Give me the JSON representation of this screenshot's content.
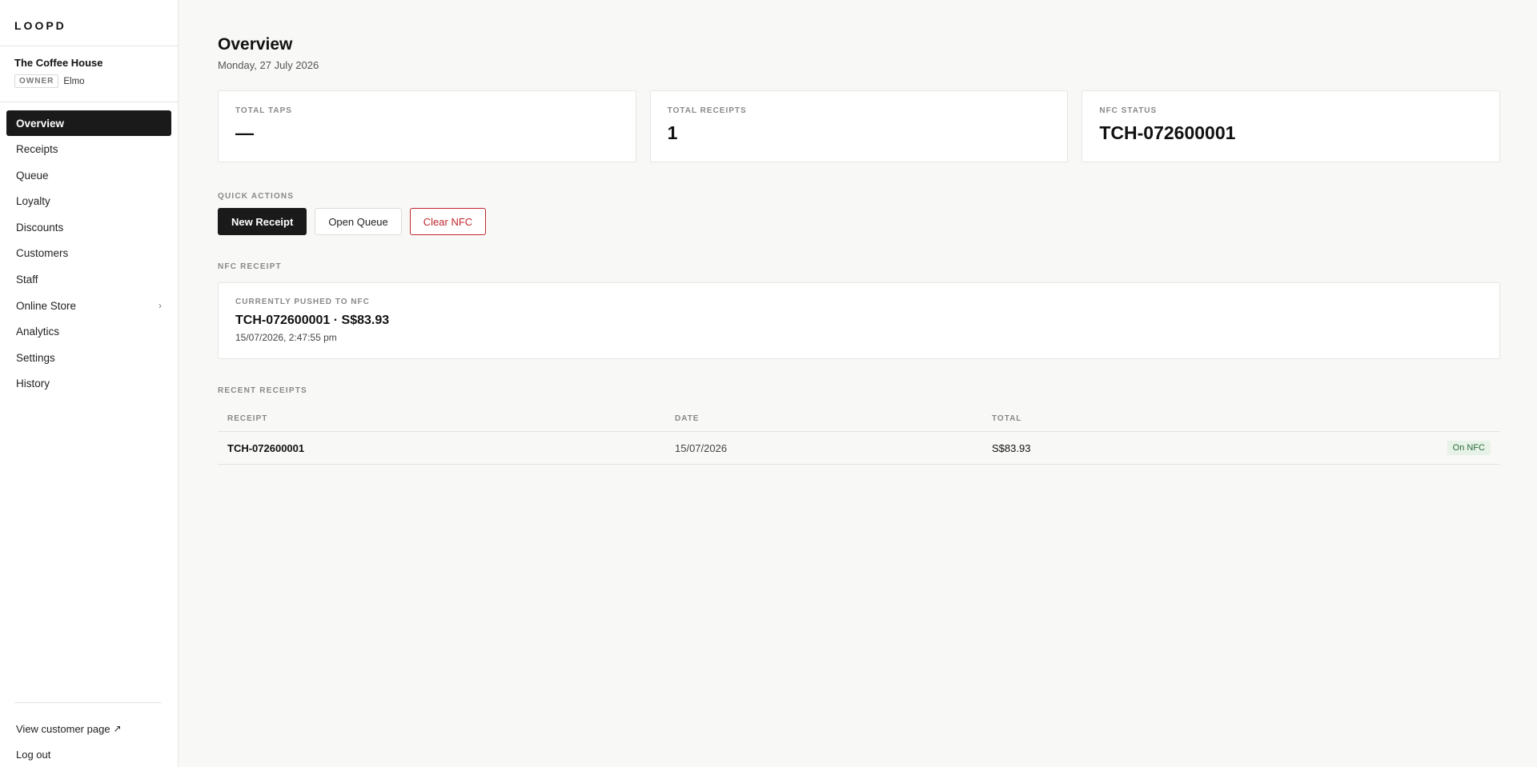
{
  "app": {
    "brand": "LOOPD"
  },
  "store": {
    "name": "The Coffee House",
    "role": "OWNER",
    "user": "Elmo"
  },
  "nav": {
    "items": [
      {
        "label": "Overview",
        "active": true
      },
      {
        "label": "Receipts"
      },
      {
        "label": "Queue"
      },
      {
        "label": "Loyalty"
      },
      {
        "label": "Discounts"
      },
      {
        "label": "Customers"
      },
      {
        "label": "Staff"
      },
      {
        "label": "Online Store",
        "chevron": "›"
      },
      {
        "label": "Analytics"
      },
      {
        "label": "Settings"
      },
      {
        "label": "History"
      }
    ]
  },
  "footer": {
    "view_customer_page": "View customer page",
    "external_glyph": "↗",
    "logout": "Log out"
  },
  "header": {
    "title": "Overview",
    "date": "Monday, 27 July 2026"
  },
  "stats": [
    {
      "label": "TOTAL TAPS",
      "value": "—"
    },
    {
      "label": "TOTAL RECEIPTS",
      "value": "1"
    },
    {
      "label": "NFC STATUS",
      "value": "TCH-072600001"
    }
  ],
  "quick_actions": {
    "label": "QUICK ACTIONS",
    "new_receipt": "New Receipt",
    "open_queue": "Open Queue",
    "clear_nfc": "Clear NFC"
  },
  "nfc_receipt": {
    "label": "NFC RECEIPT",
    "sub": "CURRENTLY PUSHED TO NFC",
    "main": "TCH-072600001 · S$83.93",
    "time": "15/07/2026, 2:47:55 pm"
  },
  "recent": {
    "label": "RECENT RECEIPTS",
    "columns": [
      "RECEIPT",
      "DATE",
      "TOTAL"
    ],
    "rows": [
      {
        "receipt": "TCH-072600001",
        "date": "15/07/2026",
        "total": "S$83.93",
        "status": "On NFC"
      }
    ]
  },
  "colors": {
    "accent": "#1a1a1a",
    "danger": "#c0262b",
    "success_bg": "#e7f2e8",
    "success_text": "#2a6b3a"
  }
}
